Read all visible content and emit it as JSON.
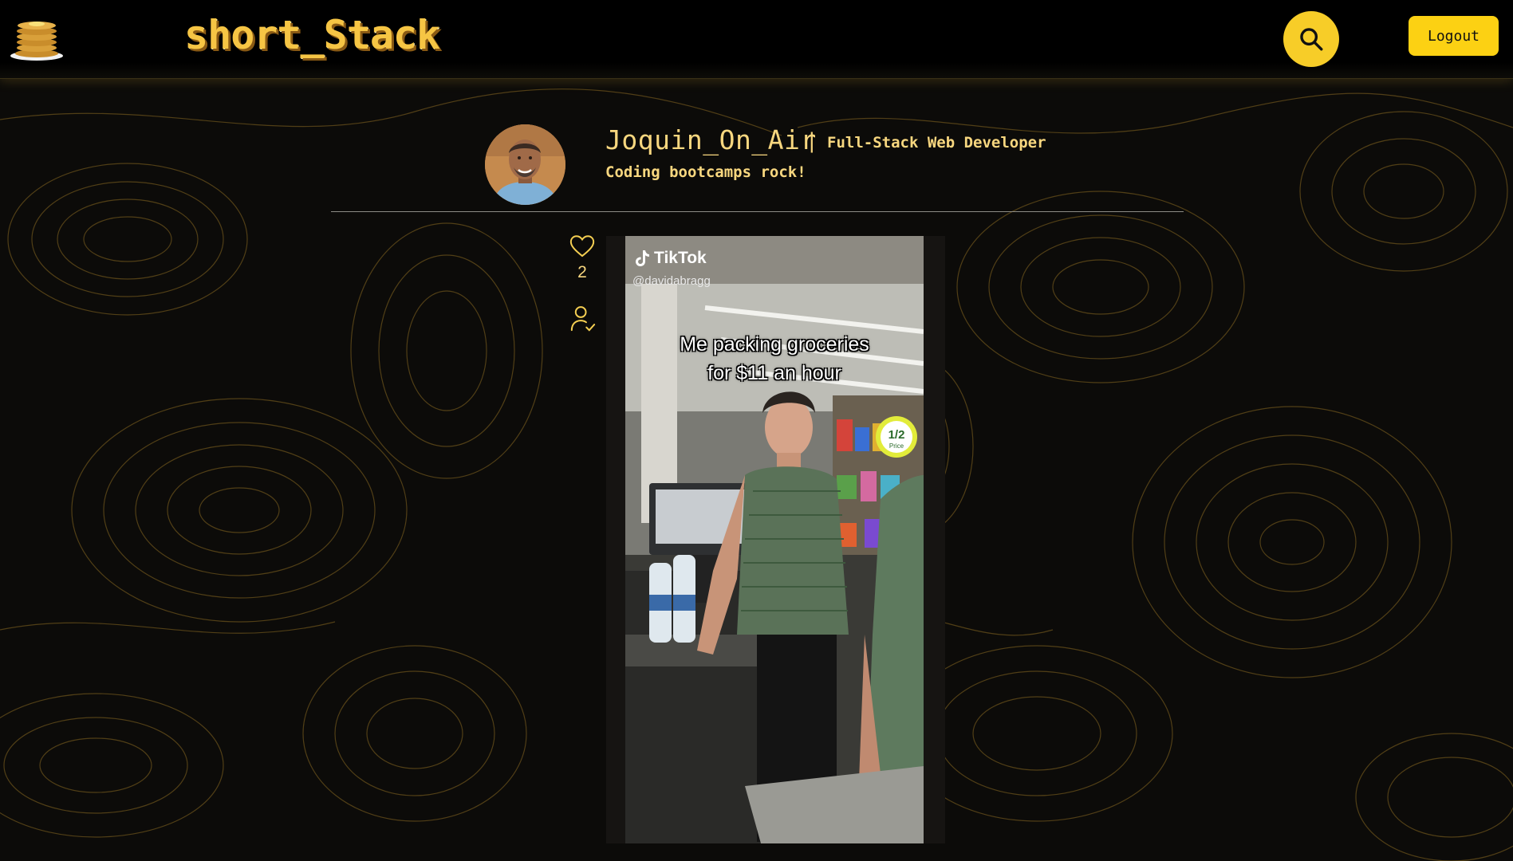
{
  "nav": {
    "brand": "short_Stack",
    "logout_label": "Logout",
    "icons": {
      "home": "pancake-stack-icon",
      "search": "search-icon"
    },
    "accent_color": "#f7cd28"
  },
  "profile": {
    "username": "Joquin_On_Air",
    "separator": "|",
    "role": "Full-Stack Web Developer",
    "bio": "Coding bootcamps rock!"
  },
  "post": {
    "like_count": "2",
    "icons": {
      "like": "heart-icon",
      "follow": "user-check-icon"
    },
    "video": {
      "platform": "TikTok",
      "handle": "@davidabragg",
      "caption_line1": "Me packing groceries",
      "caption_line2": "for $11 an hour",
      "sign_fraction": "1/2",
      "sign_word": "Price"
    }
  }
}
